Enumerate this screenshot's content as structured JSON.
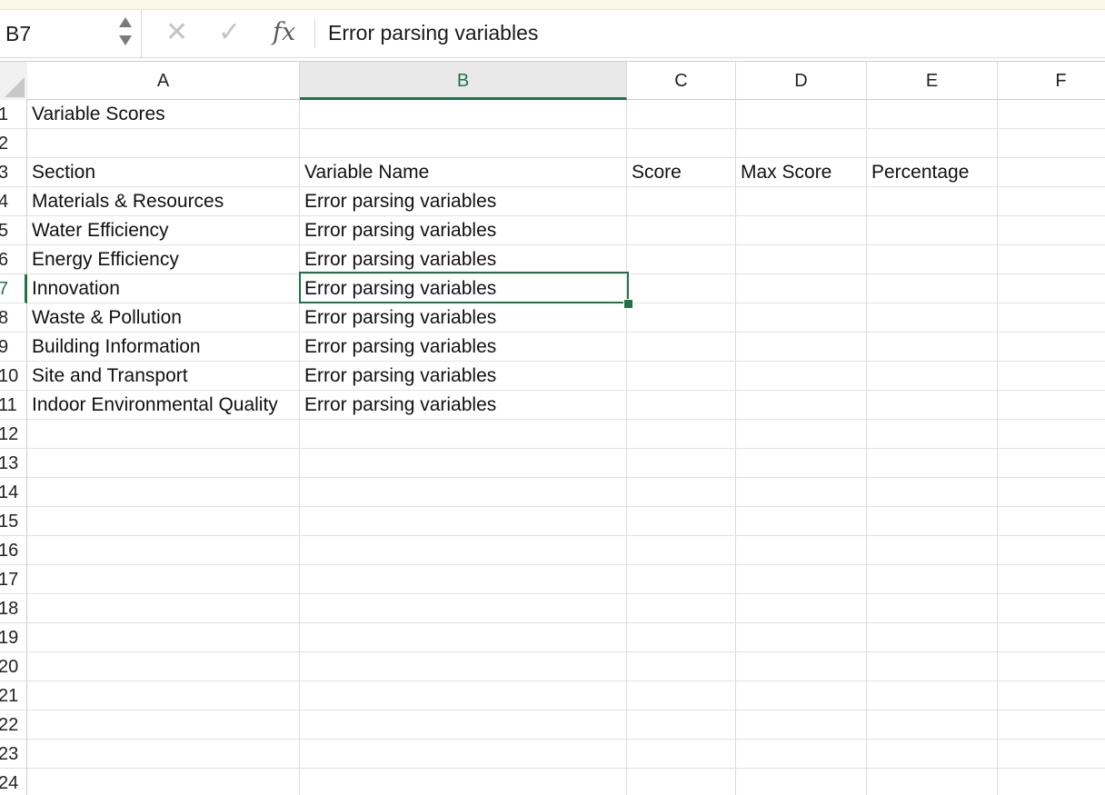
{
  "formula_bar": {
    "name_box": "B7",
    "formula": "Error parsing variables",
    "icons": {
      "cancel": "close-icon",
      "confirm": "check-icon",
      "function": "fx-icon"
    },
    "cancel_glyph": "✕",
    "confirm_glyph": "✓",
    "fx_label": "fx"
  },
  "colors": {
    "accent": "#217346",
    "gridline": "#dcdcdc",
    "header_active_bg": "#e9e9e9"
  },
  "columns": [
    "A",
    "B",
    "C",
    "D",
    "E",
    "F"
  ],
  "active_cell": {
    "column": "B",
    "row": "7"
  },
  "rows": [
    {
      "num": "1",
      "cells": [
        "Variable Scores",
        "",
        "",
        "",
        "",
        ""
      ]
    },
    {
      "num": "2",
      "cells": [
        "",
        "",
        "",
        "",
        "",
        ""
      ]
    },
    {
      "num": "3",
      "cells": [
        "Section",
        "Variable Name",
        "Score",
        "Max Score",
        "Percentage",
        ""
      ]
    },
    {
      "num": "4",
      "cells": [
        "Materials & Resources",
        "Error parsing variables",
        "",
        "",
        "",
        ""
      ]
    },
    {
      "num": "5",
      "cells": [
        "Water Efficiency",
        "Error parsing variables",
        "",
        "",
        "",
        ""
      ]
    },
    {
      "num": "6",
      "cells": [
        "Energy Efficiency",
        "Error parsing variables",
        "",
        "",
        "",
        ""
      ]
    },
    {
      "num": "7",
      "cells": [
        "Innovation",
        "Error parsing variables",
        "",
        "",
        "",
        ""
      ]
    },
    {
      "num": "8",
      "cells": [
        "Waste & Pollution",
        "Error parsing variables",
        "",
        "",
        "",
        ""
      ]
    },
    {
      "num": "9",
      "cells": [
        "Building Information",
        "Error parsing variables",
        "",
        "",
        "",
        ""
      ]
    },
    {
      "num": "10",
      "cells": [
        "Site and Transport",
        "Error parsing variables",
        "",
        "",
        "",
        ""
      ]
    },
    {
      "num": "11",
      "cells": [
        "Indoor Environmental Quality",
        "Error parsing variables",
        "",
        "",
        "",
        ""
      ]
    },
    {
      "num": "12",
      "cells": [
        "",
        "",
        "",
        "",
        "",
        ""
      ]
    },
    {
      "num": "13",
      "cells": [
        "",
        "",
        "",
        "",
        "",
        ""
      ]
    },
    {
      "num": "14",
      "cells": [
        "",
        "",
        "",
        "",
        "",
        ""
      ]
    },
    {
      "num": "15",
      "cells": [
        "",
        "",
        "",
        "",
        "",
        ""
      ]
    },
    {
      "num": "16",
      "cells": [
        "",
        "",
        "",
        "",
        "",
        ""
      ]
    },
    {
      "num": "17",
      "cells": [
        "",
        "",
        "",
        "",
        "",
        ""
      ]
    },
    {
      "num": "18",
      "cells": [
        "",
        "",
        "",
        "",
        "",
        ""
      ]
    },
    {
      "num": "19",
      "cells": [
        "",
        "",
        "",
        "",
        "",
        ""
      ]
    },
    {
      "num": "20",
      "cells": [
        "",
        "",
        "",
        "",
        "",
        ""
      ]
    },
    {
      "num": "21",
      "cells": [
        "",
        "",
        "",
        "",
        "",
        ""
      ]
    },
    {
      "num": "22",
      "cells": [
        "",
        "",
        "",
        "",
        "",
        ""
      ]
    },
    {
      "num": "23",
      "cells": [
        "",
        "",
        "",
        "",
        "",
        ""
      ]
    },
    {
      "num": "24",
      "cells": [
        "",
        "",
        "",
        "",
        "",
        ""
      ]
    }
  ]
}
